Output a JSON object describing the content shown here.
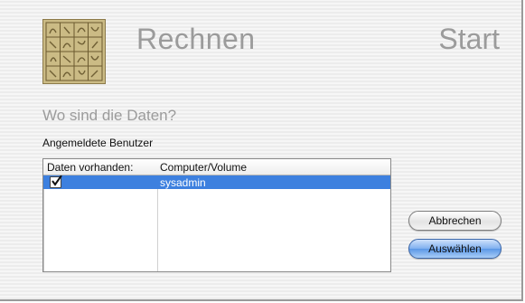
{
  "header": {
    "title": "Rechnen",
    "start_label": "Start",
    "logo_icon": "magic-square-logo-icon"
  },
  "question": "Wo sind die Daten?",
  "users_label": "Angemeldete Benutzer",
  "table": {
    "columns": [
      "Daten vorhanden:",
      "Computer/Volume"
    ],
    "rows": [
      {
        "data_available": true,
        "volume": "sysadmin",
        "selected": true
      }
    ]
  },
  "buttons": {
    "cancel_label": "Abbrechen",
    "select_label": "Auswählen"
  },
  "colors": {
    "selection": "#3d80df",
    "heading_gray": "#9b9b9b"
  }
}
